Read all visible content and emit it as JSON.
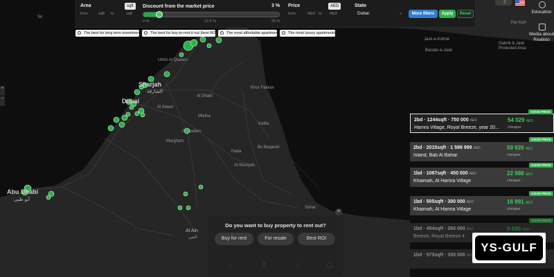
{
  "filters": {
    "area_label": "Area",
    "area_unit": "sqft",
    "area_from": "from",
    "area_from_unit": "sqft",
    "area_to": "to",
    "area_to_unit": "sqft",
    "discount_label": "Discount from the market price",
    "discount_value": "3 %",
    "discount_fraction": 0.12,
    "discount_ticks": [
      "0 %",
      "12.5 %",
      "25 %"
    ],
    "price_label": "Price",
    "price_currency": "AED",
    "price_from": "from",
    "price_from_unit": "AED",
    "price_to": "to",
    "price_to_unit": "AED",
    "state_label": "State",
    "state_value": "Dubai",
    "more_filters": "More filters",
    "apply": "Apply",
    "reset": "Reset"
  },
  "quick_filters": [
    "The best for long term investments",
    "The best for buy-to-rent it out (best ROI)",
    "The most affordable apartments",
    "The most luxury apartments"
  ],
  "top_right": {
    "education": "Education",
    "media": "Media about Realisto"
  },
  "listings": [
    {
      "badge": "GOOD PRICE",
      "title": "2bd · 1244sqft · 750 000",
      "currency": "AED",
      "address": "Hamra Village, Royal Breeze, year 20...",
      "saving": "54 029",
      "saving_currency": "AED",
      "saving_label": "cheaper"
    },
    {
      "badge": "GOOD PRICE",
      "title": "2bd · 2015sqft · 1 599 999",
      "currency": "AED",
      "address": "Island, Bab Al Bahar",
      "saving": "59 926",
      "saving_currency": "AED",
      "saving_label": "cheaper"
    },
    {
      "badge": "GOOD PRICE",
      "title": "1bd · 1067sqft · 450 000",
      "currency": "AED",
      "address": "Khaimah, Al Hamra Village",
      "saving": "22 988",
      "saving_currency": "AED",
      "saving_label": "cheaper"
    },
    {
      "badge": "GOOD PRICE",
      "title": "1bd · 505sqft · 300 000",
      "currency": "AED",
      "address": "Khaimah, Al Hamra Village",
      "saving": "16 991",
      "saving_currency": "AED",
      "saving_label": "cheaper"
    },
    {
      "badge": "GOOD PRICE",
      "title": "1bd · 454sqft · 260 000",
      "currency": "AED",
      "address": "Breeze, Royal Breeze 4",
      "saving": "9 690",
      "saving_currency": "AED",
      "saving_label": ""
    },
    {
      "badge": "",
      "title": "1bd · 573sqft · 330 000",
      "currency": "AED",
      "address": "",
      "saving": "",
      "saving_currency": "",
      "saving_label": ""
    }
  ],
  "rent_prompt": {
    "question": "Do you want to buy property to rent out?",
    "buttons": [
      "Buy for rent",
      "For resale",
      "Best ROI"
    ]
  },
  "watermark": "YS-GULF",
  "map_labels": {
    "sharjah": "Sharjah",
    "sharjah_ar": "الشارقة",
    "dubai": "Dubai",
    "abu_dhabi": "Abu Dhabi",
    "abu_dhabi_ar": "أبو ظبي",
    "al_ain": "Al Ain",
    "al_ain_ar": "العين",
    "umm_al_quwain": "Umm Al Quwain",
    "khor_fakkan": "Khor Fakkan",
    "kalba": "Kalba",
    "al_dhaid": "Al Dhaid",
    "al_aweer": "Al Aweer",
    "mleiha": "Mleiha",
    "al_madam": "Al Madam",
    "margham": "Margham",
    "hatta": "Hatta",
    "al_wasiyah": "Al Wasiyah",
    "bu_baqarah": "Bu Baqarah",
    "sohar": "Sohar",
    "bandar_e_jask": "Bandar-e-Jask",
    "jask_reserve": "Jask-e-Kohne",
    "gabrik": "Gabrik & Jask Protected Area",
    "par_kuh": "Par Kuh",
    "sir": "Sir"
  },
  "colors": {
    "accent_green": "#2db04b",
    "more_filters_blue": "#2f7fd0",
    "map_bg": "#161616"
  }
}
